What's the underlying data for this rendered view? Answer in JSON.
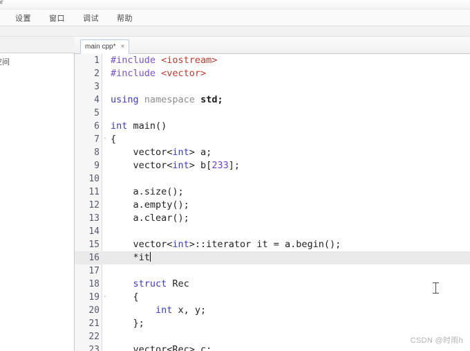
{
  "window": {
    "title_fragment": "or"
  },
  "menubar": {
    "items": [
      {
        "label": "设置"
      },
      {
        "label": "窗口"
      },
      {
        "label": "调试"
      },
      {
        "label": "帮助"
      }
    ]
  },
  "left_panel": {
    "label": "空间"
  },
  "tabs": [
    {
      "label": "main cpp*",
      "close": "×",
      "active": true
    }
  ],
  "editor": {
    "current_line": 16,
    "lines": [
      {
        "n": "1",
        "fold": "",
        "tokens": [
          {
            "t": "#include ",
            "c": "t-pre"
          },
          {
            "t": "<iostream>",
            "c": "t-str"
          }
        ]
      },
      {
        "n": "2",
        "fold": "",
        "tokens": [
          {
            "t": "#include ",
            "c": "t-pre"
          },
          {
            "t": "<vector>",
            "c": "t-str"
          }
        ]
      },
      {
        "n": "3",
        "fold": "",
        "tokens": []
      },
      {
        "n": "4",
        "fold": "",
        "tokens": [
          {
            "t": "using ",
            "c": "t-kw"
          },
          {
            "t": "namespace ",
            "c": "t-dim"
          },
          {
            "t": "std;",
            "c": "t-bold"
          }
        ]
      },
      {
        "n": "5",
        "fold": "",
        "tokens": []
      },
      {
        "n": "6",
        "fold": "",
        "tokens": [
          {
            "t": "int ",
            "c": "t-kw"
          },
          {
            "t": "main()",
            "c": "t-plain"
          }
        ]
      },
      {
        "n": "7",
        "fold": "·",
        "tokens": [
          {
            "t": "{",
            "c": "t-plain"
          }
        ]
      },
      {
        "n": "8",
        "fold": "",
        "tokens": [
          {
            "t": "    vector<",
            "c": "t-plain"
          },
          {
            "t": "int",
            "c": "t-type"
          },
          {
            "t": "> a;",
            "c": "t-plain"
          }
        ]
      },
      {
        "n": "9",
        "fold": "",
        "tokens": [
          {
            "t": "    vector<",
            "c": "t-plain"
          },
          {
            "t": "int",
            "c": "t-type"
          },
          {
            "t": "> b[",
            "c": "t-plain"
          },
          {
            "t": "233",
            "c": "t-num"
          },
          {
            "t": "];",
            "c": "t-plain"
          }
        ]
      },
      {
        "n": "10",
        "fold": "",
        "tokens": []
      },
      {
        "n": "11",
        "fold": "",
        "tokens": [
          {
            "t": "    a.size();",
            "c": "t-plain"
          }
        ]
      },
      {
        "n": "12",
        "fold": "",
        "tokens": [
          {
            "t": "    a.empty();",
            "c": "t-plain"
          }
        ]
      },
      {
        "n": "13",
        "fold": "",
        "tokens": [
          {
            "t": "    a.clear();",
            "c": "t-plain"
          }
        ]
      },
      {
        "n": "14",
        "fold": "",
        "tokens": []
      },
      {
        "n": "15",
        "fold": "",
        "tokens": [
          {
            "t": "    vector<",
            "c": "t-plain"
          },
          {
            "t": "int",
            "c": "t-type"
          },
          {
            "t": ">::iterator it = a.begin();",
            "c": "t-plain"
          }
        ]
      },
      {
        "n": "16",
        "fold": "",
        "caret": true,
        "tokens": [
          {
            "t": "    *it",
            "c": "t-plain"
          }
        ]
      },
      {
        "n": "17",
        "fold": "",
        "tokens": []
      },
      {
        "n": "18",
        "fold": "",
        "tokens": [
          {
            "t": "    struct ",
            "c": "t-kw"
          },
          {
            "t": "Rec",
            "c": "t-plain"
          }
        ]
      },
      {
        "n": "19",
        "fold": "·",
        "tokens": [
          {
            "t": "    {",
            "c": "t-plain"
          }
        ]
      },
      {
        "n": "20",
        "fold": "",
        "tokens": [
          {
            "t": "        int ",
            "c": "t-kw"
          },
          {
            "t": "x, y;",
            "c": "t-plain"
          }
        ]
      },
      {
        "n": "21",
        "fold": "",
        "tokens": [
          {
            "t": "    };",
            "c": "t-plain"
          }
        ]
      },
      {
        "n": "22",
        "fold": "",
        "tokens": []
      },
      {
        "n": "23",
        "fold": "",
        "tokens": [
          {
            "t": "    vector<Rec> c;",
            "c": "t-plain"
          }
        ]
      }
    ]
  },
  "watermark": {
    "text": "CSDN @时雨h"
  }
}
